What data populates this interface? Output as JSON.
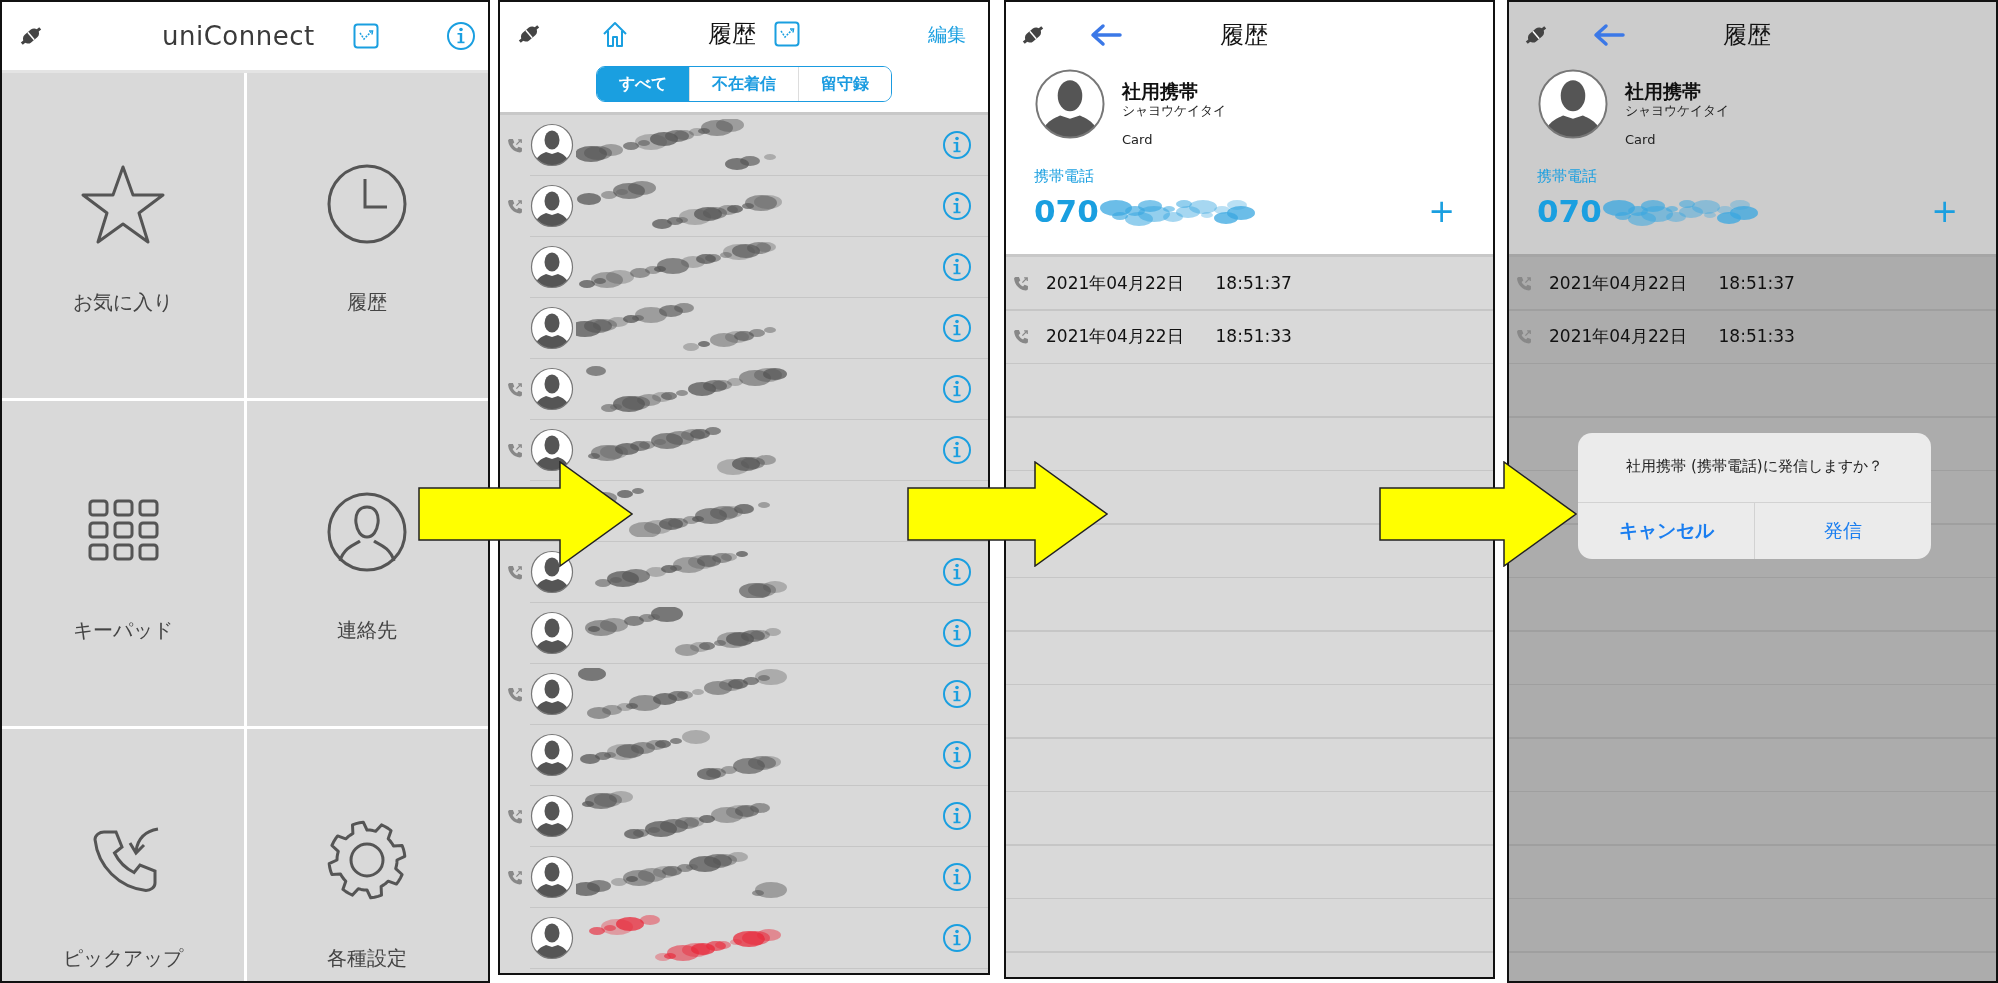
{
  "panels": [
    {
      "kind": "home",
      "title": "uniConnect",
      "tiles": [
        {
          "kind": "favorites",
          "label": "お気に入り"
        },
        {
          "kind": "history",
          "label": "履歴"
        },
        {
          "kind": "keypad",
          "label": "キーパッド"
        },
        {
          "kind": "contacts",
          "label": "連絡先"
        },
        {
          "kind": "pickup",
          "label": "ピックアップ"
        },
        {
          "kind": "settings",
          "label": "各種設定"
        }
      ]
    },
    {
      "kind": "history",
      "title": "履歴",
      "edit": "編集",
      "segments": [
        {
          "label": "すべて",
          "selected": true
        },
        {
          "label": "不在着信",
          "selected": false
        },
        {
          "label": "留守録",
          "selected": false
        }
      ],
      "rows": [
        {
          "kind": "entry",
          "outgoing": true,
          "missed": false
        },
        {
          "kind": "entry",
          "outgoing": true,
          "missed": false
        },
        {
          "kind": "entry",
          "outgoing": false,
          "missed": false
        },
        {
          "kind": "entry",
          "outgoing": false,
          "missed": false
        },
        {
          "kind": "entry",
          "outgoing": true,
          "missed": false
        },
        {
          "kind": "entry",
          "outgoing": true,
          "missed": false
        },
        {
          "kind": "covered",
          "outgoing": false,
          "missed": false
        },
        {
          "kind": "entry",
          "outgoing": true,
          "missed": false
        },
        {
          "kind": "entry",
          "outgoing": false,
          "missed": false
        },
        {
          "kind": "entry",
          "outgoing": true,
          "missed": false
        },
        {
          "kind": "entry",
          "outgoing": false,
          "missed": false
        },
        {
          "kind": "entry",
          "outgoing": true,
          "missed": false
        },
        {
          "kind": "entry",
          "outgoing": true,
          "missed": false
        },
        {
          "kind": "entry",
          "outgoing": false,
          "missed": true
        }
      ]
    },
    {
      "kind": "detail",
      "dimmed": false,
      "title": "履歴",
      "contact": {
        "name": "社用携帯",
        "reading": "シャヨウケイタイ",
        "note": "Card"
      },
      "phone": {
        "label": "携帯電話",
        "prefix": "070",
        "add": "+"
      },
      "calls": [
        {
          "date": "2021年04月22日",
          "time": "18:51:37"
        },
        {
          "date": "2021年04月22日",
          "time": "18:51:33"
        }
      ]
    },
    {
      "kind": "detail",
      "dimmed": true,
      "title": "履歴",
      "contact": {
        "name": "社用携帯",
        "reading": "シャヨウケイタイ",
        "note": "Card"
      },
      "phone": {
        "label": "携帯電話",
        "prefix": "070",
        "add": "+"
      },
      "calls": [
        {
          "date": "2021年04月22日",
          "time": "18:51:37"
        },
        {
          "date": "2021年04月22日",
          "time": "18:51:33"
        }
      ],
      "alert": {
        "message": "社用携帯 (携帯電話)に発信しますか？",
        "buttons": [
          {
            "label": "キャンセル",
            "kind": "cancel"
          },
          {
            "label": "発信",
            "kind": "default"
          }
        ]
      }
    }
  ]
}
